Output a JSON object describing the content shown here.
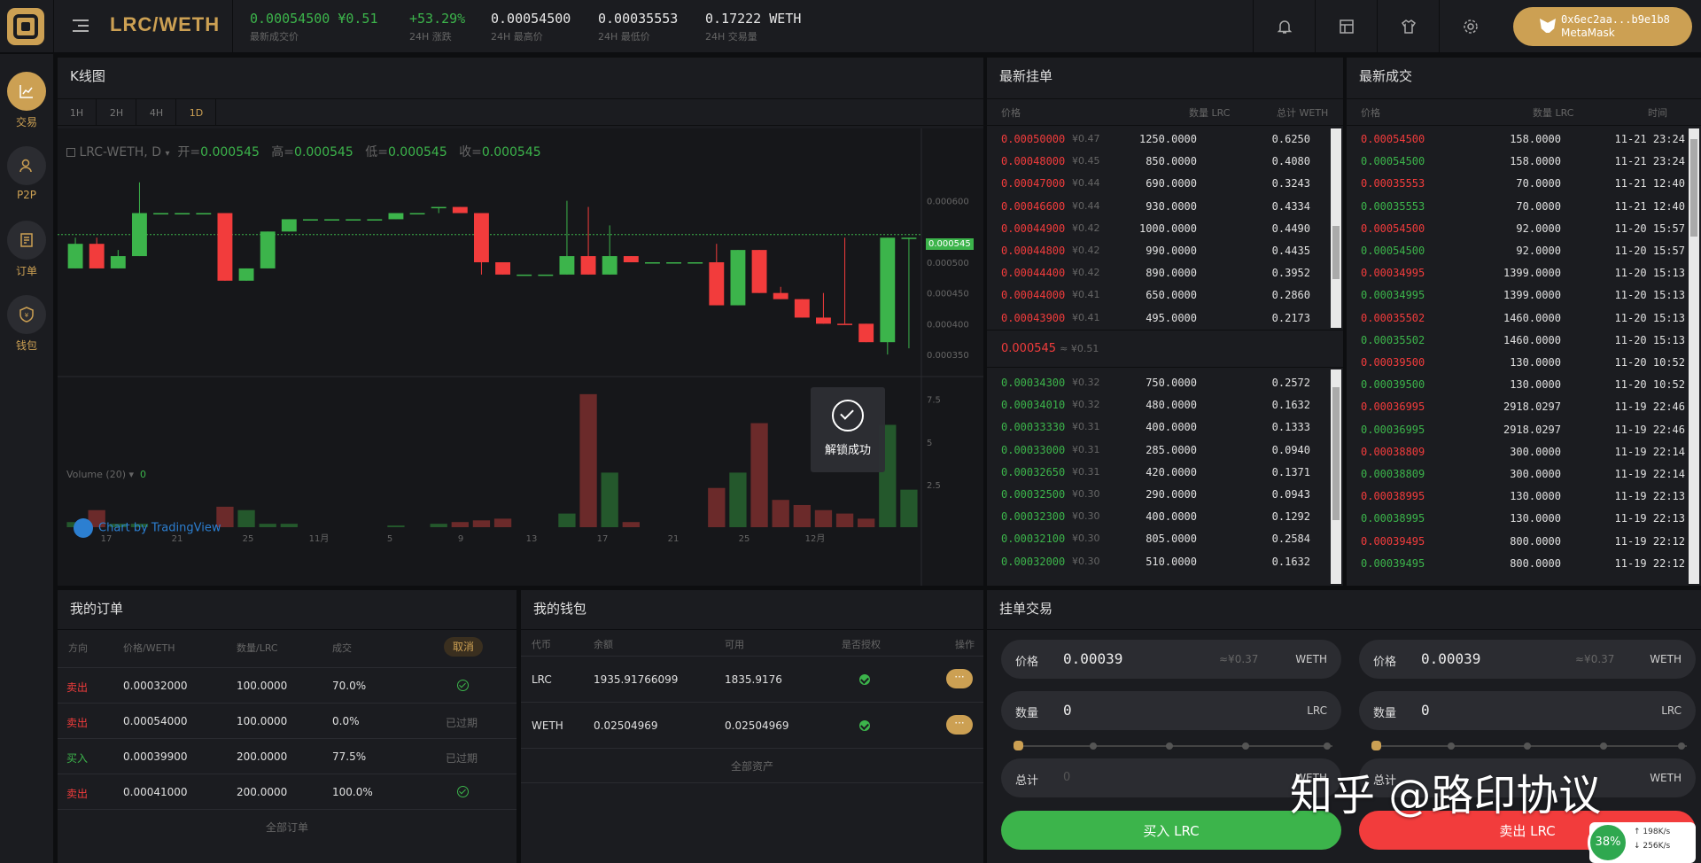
{
  "header": {
    "pair": "LRC/WETH",
    "stats": [
      {
        "value": "0.00054500",
        "extra": "¥0.51",
        "label": "最新成交价",
        "color": "#3cb44b"
      },
      {
        "value": "+53.29%",
        "label": "24H 涨跌",
        "color": "#3cb44b"
      },
      {
        "value": "0.00054500",
        "label": "24H 最高价"
      },
      {
        "value": "0.00035553",
        "label": "24H 最低价"
      },
      {
        "value": "0.17222 WETH",
        "label": "24H 交易量"
      }
    ],
    "wallet_address": "0x6ec2aa...b9e1b8",
    "wallet_name": "MetaMask",
    "icons": [
      "bell-icon",
      "layout-icon",
      "shirt-icon",
      "gear-icon"
    ]
  },
  "sidebar": {
    "items": [
      {
        "label": "交易",
        "icon": "chart-icon",
        "active": true
      },
      {
        "label": "P2P",
        "icon": "users-icon",
        "active": false
      },
      {
        "label": "订单",
        "icon": "orders-icon",
        "active": false
      },
      {
        "label": "钱包",
        "icon": "wallet-icon",
        "active": false
      }
    ]
  },
  "kline": {
    "title": "K线图",
    "tabs": [
      "1H",
      "2H",
      "4H",
      "1D"
    ],
    "active_tab": "1D",
    "legend_symbol": "LRC-WETH, D",
    "ohlc": {
      "open_label": "开=",
      "open": "0.000545",
      "high_label": "高=",
      "high": "0.000545",
      "low_label": "低=",
      "low": "0.000545",
      "close_label": "收=",
      "close": "0.000545"
    },
    "price_tag": "0.000545",
    "volume_label": "Volume (20)",
    "volume_value": "0",
    "tradingview": "Chart by TradingView",
    "unlock_text": "解锁成功"
  },
  "chart_data": {
    "type": "candlestick",
    "y_ticks": [
      "0.000600",
      "0.000500",
      "0.000450",
      "0.000400",
      "0.000350"
    ],
    "vol_ticks": [
      "7.5",
      "5",
      "2.5"
    ],
    "x_ticks": [
      "17",
      "21",
      "25",
      "11月",
      "5",
      "9",
      "13",
      "17",
      "21",
      "25",
      "12月"
    ],
    "ylim": [
      0.00034,
      0.00066
    ],
    "vol_max": 8,
    "candles": [
      [
        0.00049,
        0.00053,
        0.00054,
        0.00049,
        0.3,
        "up"
      ],
      [
        0.00053,
        0.00049,
        0.00054,
        0.00049,
        1.0,
        "down"
      ],
      [
        0.00049,
        0.00051,
        0.00052,
        0.00049,
        0.2,
        "up"
      ],
      [
        0.00051,
        0.00058,
        0.00063,
        0.00051,
        0.2,
        "up"
      ],
      [
        0.00058,
        0.00058,
        0.00058,
        0.00058,
        0,
        "up"
      ],
      [
        0.00058,
        0.00058,
        0.00058,
        0.00058,
        0,
        "up"
      ],
      [
        0.00058,
        0.00058,
        0.00058,
        0.00058,
        0,
        "up"
      ],
      [
        0.00058,
        0.00047,
        0.00058,
        0.00047,
        1.2,
        "down"
      ],
      [
        0.00047,
        0.00049,
        0.00049,
        0.00047,
        1.0,
        "up"
      ],
      [
        0.00049,
        0.00055,
        0.00055,
        0.00049,
        0.2,
        "up"
      ],
      [
        0.00055,
        0.00057,
        0.00057,
        0.00055,
        0.2,
        "up"
      ],
      [
        0.00057,
        0.00057,
        0.00057,
        0.00057,
        0,
        "up"
      ],
      [
        0.00057,
        0.00057,
        0.00057,
        0.00057,
        0,
        "up"
      ],
      [
        0.00057,
        0.00057,
        0.00057,
        0.00057,
        0,
        "up"
      ],
      [
        0.00057,
        0.00057,
        0.00057,
        0.00057,
        0,
        "up"
      ],
      [
        0.00057,
        0.00058,
        0.00058,
        0.00057,
        0.1,
        "up"
      ],
      [
        0.00058,
        0.00058,
        0.00058,
        0.00058,
        0,
        "up"
      ],
      [
        0.00059,
        0.00059,
        0.00059,
        0.00058,
        0.2,
        "up"
      ],
      [
        0.00059,
        0.00058,
        0.00059,
        0.00058,
        0.3,
        "down"
      ],
      [
        0.00058,
        0.0005,
        0.00058,
        0.00048,
        0.4,
        "down"
      ],
      [
        0.0005,
        0.00048,
        0.0005,
        0.00048,
        0.5,
        "down"
      ],
      [
        0.00048,
        0.00048,
        0.00048,
        0.00048,
        0,
        "up"
      ],
      [
        0.00048,
        0.00048,
        0.00048,
        0.00048,
        0,
        "up"
      ],
      [
        0.00048,
        0.00051,
        0.0006,
        0.00048,
        0.8,
        "up"
      ],
      [
        0.00051,
        0.00048,
        0.00059,
        0.00048,
        7.8,
        "down"
      ],
      [
        0.00048,
        0.00051,
        0.00056,
        0.00048,
        3.2,
        "up"
      ],
      [
        0.00051,
        0.0005,
        0.00051,
        0.0005,
        0.3,
        "down"
      ],
      [
        0.0005,
        0.0005,
        0.0005,
        0.0005,
        0,
        "up"
      ],
      [
        0.0005,
        0.0005,
        0.0005,
        0.0005,
        0,
        "up"
      ],
      [
        0.0005,
        0.0005,
        0.0005,
        0.0005,
        0,
        "up"
      ],
      [
        0.0005,
        0.00043,
        0.00053,
        0.00043,
        2.3,
        "down"
      ],
      [
        0.00043,
        0.00052,
        0.00052,
        0.00043,
        3.2,
        "up"
      ],
      [
        0.00052,
        0.00045,
        0.00052,
        0.00045,
        6.1,
        "down"
      ],
      [
        0.00045,
        0.00044,
        0.00046,
        0.00044,
        1.6,
        "down"
      ],
      [
        0.00044,
        0.00041,
        0.00044,
        0.00041,
        1.3,
        "down"
      ],
      [
        0.00041,
        0.0004,
        0.00045,
        0.0004,
        1.0,
        "down"
      ],
      [
        0.0004,
        0.0004,
        0.00054,
        0.0004,
        0.8,
        "down"
      ],
      [
        0.0004,
        0.00037,
        0.0004,
        0.00037,
        0.5,
        "down"
      ],
      [
        0.00037,
        0.00054,
        0.00054,
        0.00035,
        6.0,
        "up"
      ],
      [
        0.00054,
        0.00054,
        0.00054,
        0.00036,
        2.2,
        "up"
      ]
    ]
  },
  "orderbook": {
    "title": "最新挂单",
    "headers": [
      "价格",
      "数量 LRC",
      "总计 WETH"
    ],
    "asks": [
      [
        "0.00050000",
        "¥0.47",
        "1250.0000",
        "0.6250"
      ],
      [
        "0.00048000",
        "¥0.45",
        "850.0000",
        "0.4080"
      ],
      [
        "0.00047000",
        "¥0.44",
        "690.0000",
        "0.3243"
      ],
      [
        "0.00046600",
        "¥0.44",
        "930.0000",
        "0.4334"
      ],
      [
        "0.00044900",
        "¥0.42",
        "1000.0000",
        "0.4490"
      ],
      [
        "0.00044800",
        "¥0.42",
        "990.0000",
        "0.4435"
      ],
      [
        "0.00044400",
        "¥0.42",
        "890.0000",
        "0.3952"
      ],
      [
        "0.00044000",
        "¥0.41",
        "650.0000",
        "0.2860"
      ],
      [
        "0.00043900",
        "¥0.41",
        "495.0000",
        "0.2173"
      ]
    ],
    "last_price": "0.000545",
    "last_price_cny": "≈ ¥0.51",
    "bids": [
      [
        "0.00034300",
        "¥0.32",
        "750.0000",
        "0.2572"
      ],
      [
        "0.00034010",
        "¥0.32",
        "480.0000",
        "0.1632"
      ],
      [
        "0.00033330",
        "¥0.31",
        "400.0000",
        "0.1333"
      ],
      [
        "0.00033000",
        "¥0.31",
        "285.0000",
        "0.0940"
      ],
      [
        "0.00032650",
        "¥0.31",
        "420.0000",
        "0.1371"
      ],
      [
        "0.00032500",
        "¥0.30",
        "290.0000",
        "0.0943"
      ],
      [
        "0.00032300",
        "¥0.30",
        "400.0000",
        "0.1292"
      ],
      [
        "0.00032100",
        "¥0.30",
        "805.0000",
        "0.2584"
      ],
      [
        "0.00032000",
        "¥0.30",
        "510.0000",
        "0.1632"
      ]
    ]
  },
  "trades": {
    "title": "最新成交",
    "headers": [
      "价格",
      "数量 LRC",
      "时间"
    ],
    "rows": [
      [
        "0.00054500",
        "158.0000",
        "11-21 23:24",
        "red"
      ],
      [
        "0.00054500",
        "158.0000",
        "11-21 23:24",
        "green"
      ],
      [
        "0.00035553",
        "70.0000",
        "11-21 12:40",
        "red"
      ],
      [
        "0.00035553",
        "70.0000",
        "11-21 12:40",
        "green"
      ],
      [
        "0.00054500",
        "92.0000",
        "11-20 15:57",
        "red"
      ],
      [
        "0.00054500",
        "92.0000",
        "11-20 15:57",
        "green"
      ],
      [
        "0.00034995",
        "1399.0000",
        "11-20 15:13",
        "red"
      ],
      [
        "0.00034995",
        "1399.0000",
        "11-20 15:13",
        "green"
      ],
      [
        "0.00035502",
        "1460.0000",
        "11-20 15:13",
        "red"
      ],
      [
        "0.00035502",
        "1460.0000",
        "11-20 15:13",
        "green"
      ],
      [
        "0.00039500",
        "130.0000",
        "11-20 10:52",
        "red"
      ],
      [
        "0.00039500",
        "130.0000",
        "11-20 10:52",
        "green"
      ],
      [
        "0.00036995",
        "2918.0297",
        "11-19 22:46",
        "red"
      ],
      [
        "0.00036995",
        "2918.0297",
        "11-19 22:46",
        "green"
      ],
      [
        "0.00038809",
        "300.0000",
        "11-19 22:14",
        "red"
      ],
      [
        "0.00038809",
        "300.0000",
        "11-19 22:14",
        "green"
      ],
      [
        "0.00038995",
        "130.0000",
        "11-19 22:13",
        "red"
      ],
      [
        "0.00038995",
        "130.0000",
        "11-19 22:13",
        "green"
      ],
      [
        "0.00039495",
        "800.0000",
        "11-19 22:12",
        "red"
      ],
      [
        "0.00039495",
        "800.0000",
        "11-19 22:12",
        "green"
      ]
    ]
  },
  "my_orders": {
    "title": "我的订单",
    "headers": [
      "方向",
      "价格/WETH",
      "数量/LRC",
      "成交"
    ],
    "cancel_label": "取消",
    "rows": [
      {
        "side": "卖出",
        "price": "0.00032000",
        "amount": "100.0000",
        "filled": "70.0%",
        "status": "check",
        "color": "red"
      },
      {
        "side": "卖出",
        "price": "0.00054000",
        "amount": "100.0000",
        "filled": "0.0%",
        "status": "已过期",
        "color": "red"
      },
      {
        "side": "买入",
        "price": "0.00039900",
        "amount": "200.0000",
        "filled": "77.5%",
        "status": "已过期",
        "color": "green"
      },
      {
        "side": "卖出",
        "price": "0.00041000",
        "amount": "200.0000",
        "filled": "100.0%",
        "status": "check",
        "color": "red"
      }
    ],
    "all_label": "全部订单"
  },
  "my_wallet": {
    "title": "我的钱包",
    "headers": [
      "代币",
      "余额",
      "可用",
      "是否授权",
      "操作"
    ],
    "rows": [
      {
        "token": "LRC",
        "balance": "1935.91766099",
        "available": "1835.9176"
      },
      {
        "token": "WETH",
        "balance": "0.02504969",
        "available": "0.02504969"
      }
    ],
    "more_label": "···",
    "all_label": "全部资产"
  },
  "trade_form": {
    "title": "挂单交易",
    "buy": {
      "price_label": "价格",
      "price": "0.00039",
      "price_cny": "≈¥0.37",
      "price_unit": "WETH",
      "amount_label": "数量",
      "amount": "0",
      "amount_unit": "LRC",
      "total_label": "总计",
      "total": "0",
      "total_unit": "WETH",
      "button": "买入 LRC"
    },
    "sell": {
      "price_label": "价格",
      "price": "0.00039",
      "price_cny": "≈¥0.37",
      "price_unit": "WETH",
      "amount_label": "数量",
      "amount": "0",
      "amount_unit": "LRC",
      "total_label": "总计",
      "total_unit": "WETH",
      "button": "卖出 LRC"
    }
  },
  "watermark": "知乎 @路印协议",
  "net_widget": {
    "percent": "38%",
    "up": "198K/s",
    "down": "256K/s"
  },
  "colors": {
    "accent": "#cca053",
    "up": "#3cb44b",
    "down": "#f23c3c",
    "panel": "#1b1c20",
    "bg": "#0d0e10"
  }
}
